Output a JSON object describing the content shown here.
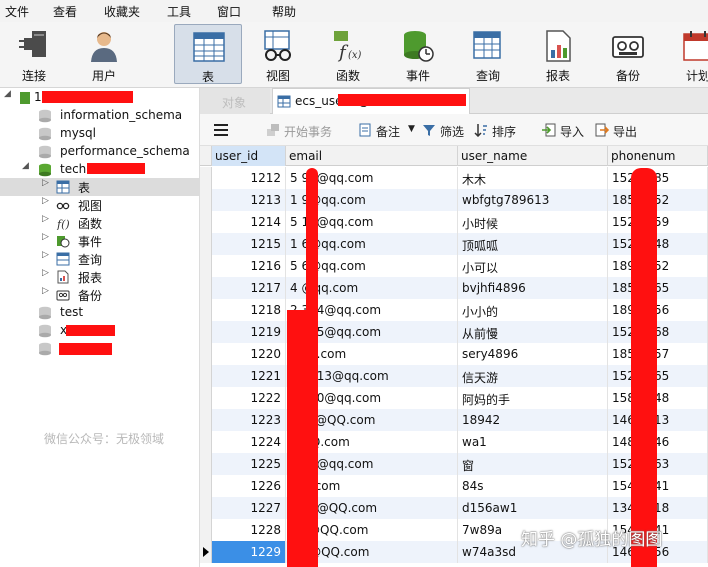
{
  "menu": [
    "文件",
    "查看",
    "收藏夹",
    "工具",
    "窗口",
    "帮助"
  ],
  "toolbar": [
    "连接",
    "用户",
    "表",
    "视图",
    "函数",
    "事件",
    "查询",
    "报表",
    "备份",
    "计划"
  ],
  "tree": {
    "root_prefix": "1",
    "dbs": [
      "information_schema",
      "mysql",
      "performance_schema"
    ],
    "open_db_prefix": "tech",
    "children": [
      "表",
      "视图",
      "函数",
      "事件",
      "查询",
      "报表",
      "备份"
    ],
    "other_dbs": [
      "test",
      "x",
      ""
    ]
  },
  "watermark_left": "微信公众号：无极领域",
  "tabs": {
    "objects": "对象",
    "active": "ecs_users @t"
  },
  "data_toolbar": {
    "begin_tx": "开始事务",
    "note": "备注",
    "filter": "筛选",
    "sort": "排序",
    "import": "导入",
    "export": "导出"
  },
  "grid": {
    "columns": [
      "user_id",
      "email",
      "user_name",
      "phonenum"
    ],
    "rows": [
      {
        "id": "1212",
        "email": "5        99@qq.com",
        "name": "木木",
        "phone": "152        5985"
      },
      {
        "id": "1213",
        "email": "1         9@qq.com",
        "name": "wbfgtg789613",
        "phone": "185        4552"
      },
      {
        "id": "1214",
        "email": "5        16@qq.com",
        "name": "小时候",
        "phone": "152        8659"
      },
      {
        "id": "1215",
        "email": "1         6@qq.com",
        "name": "顶呱呱",
        "phone": "152        9548"
      },
      {
        "id": "1216",
        "email": "5         6@qq.com",
        "name": "小可以",
        "phone": "189        4852"
      },
      {
        "id": "1217",
        "email": "4          @qq.com",
        "name": "bvjhfi4896",
        "phone": "185        9665"
      },
      {
        "id": "1218",
        "email": "2       354@qq.com",
        "name": "小小的",
        "phone": "189        5956"
      },
      {
        "id": "1219",
        "email": "6       265@qq.com",
        "name": "从前慢",
        "phone": "152        8568"
      },
      {
        "id": "1220",
        "email": "6         qq.com",
        "name": "sery4896",
        "phone": "185        9557"
      },
      {
        "id": "1221",
        "email": "2        9413@qq.com",
        "name": "信天游",
        "phone": "152        5965"
      },
      {
        "id": "1222",
        "email": "1       360@qq.com",
        "name": "阿妈的手",
        "phone": "158        9548"
      },
      {
        "id": "1223",
        "email": "4        sa@QQ.com",
        "name": "18942",
        "phone": "146        4313"
      },
      {
        "id": "1224",
        "email": "1         QQ.com",
        "name": "wa1",
        "phone": "148        4646"
      },
      {
        "id": "1225",
        "email": "1        08@qq.com",
        "name": "窗",
        "phone": "152        8563"
      },
      {
        "id": "1226",
        "email": "1         Q.com",
        "name": "84s",
        "phone": "154        3741"
      },
      {
        "id": "1227",
        "email": "1        45@QQ.com",
        "name": "d156aw1",
        "phone": "134        5418"
      },
      {
        "id": "1228",
        "email": "c        4@QQ.com",
        "name": "7w89a",
        "phone": "154        6841"
      },
      {
        "id": "1229",
        "email": "1        1@QQ.com",
        "name": "w74a3sd",
        "phone": "146        6456"
      }
    ]
  },
  "watermark_right": "知乎 @孤独的图图",
  "colors": {
    "redaction": "#ff1010",
    "selection": "#3b8fe6",
    "row_alt": "#eef3fb",
    "toolbar_active": "#d7dfe9"
  }
}
